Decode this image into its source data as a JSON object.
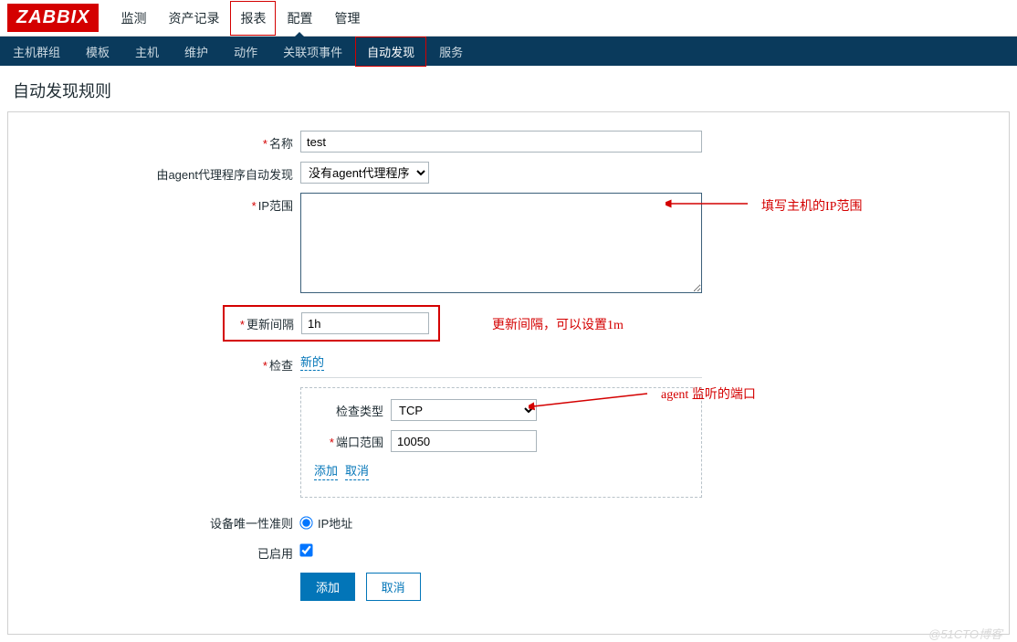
{
  "logo": "ZABBIX",
  "top_nav": {
    "items": [
      "监测",
      "资产记录",
      "报表",
      "配置",
      "管理"
    ],
    "highlighted_index": 2,
    "active_index": 3
  },
  "sub_nav": {
    "items": [
      "主机群组",
      "模板",
      "主机",
      "维护",
      "动作",
      "关联项事件",
      "自动发现",
      "服务"
    ],
    "highlighted_index": 6
  },
  "page_title": "自动发现规则",
  "form": {
    "name_label": "名称",
    "name_value": "test",
    "agent_proxy_label": "由agent代理程序自动发现",
    "agent_proxy_value": "没有agent代理程序",
    "ip_range_label": "IP范围",
    "ip_range_value": "",
    "update_interval_label": "更新间隔",
    "update_interval_value": "1h",
    "checks_label": "检查",
    "checks_new_link": "新的",
    "check_type_label": "检查类型",
    "check_type_value": "TCP",
    "port_range_label": "端口范围",
    "port_range_value": "10050",
    "add_link": "添加",
    "cancel_link": "取消",
    "unique_label": "设备唯一性准则",
    "unique_option": "IP地址",
    "enabled_label": "已启用",
    "enabled_checked": true,
    "submit_label": "添加",
    "cancel_btn_label": "取消"
  },
  "annotations": {
    "ip_note": "填写主机的IP范围",
    "interval_note": "更新间隔，可以设置1m",
    "agent_note": "agent 监听的端口"
  },
  "watermark": "@51CTO博客"
}
